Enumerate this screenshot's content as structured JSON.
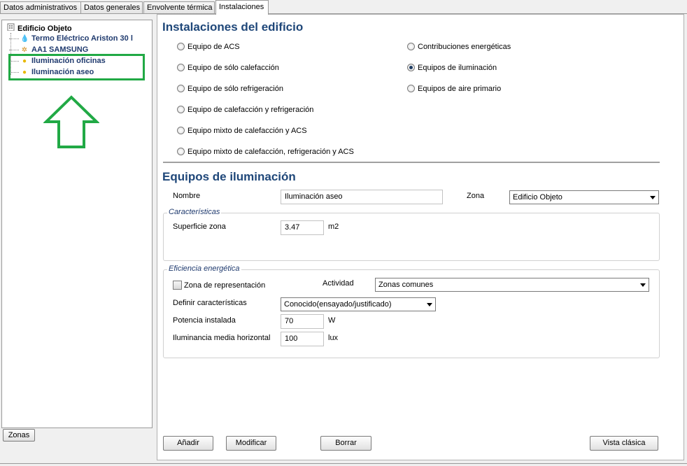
{
  "tabs": [
    "Datos administrativos",
    "Datos generales",
    "Envolvente térmica",
    "Instalaciones"
  ],
  "tree": {
    "root": "Edificio Objeto",
    "items": [
      {
        "label": "Termo Eléctrico Ariston 30 l",
        "icon": "water-drop-icon",
        "color": "#2a7fd4"
      },
      {
        "label": "AA1 SAMSUNG",
        "icon": "hvac-icon",
        "color": "#d08a1a"
      },
      {
        "label": "Iluminación oficinas",
        "icon": "lightbulb-icon",
        "color": "#e8b800"
      },
      {
        "label": "Iluminación aseo",
        "icon": "lightbulb-icon",
        "color": "#e8b800"
      }
    ]
  },
  "zonas_button": "Zonas",
  "section1": {
    "title": "Instalaciones del edificio",
    "left_options": [
      "Equipo de ACS",
      "Equipo de sólo calefacción",
      "Equipo de sólo refrigeración",
      "Equipo de calefacción y refrigeración",
      "Equipo mixto de calefacción y ACS",
      "Equipo mixto de calefacción, refrigeración y ACS"
    ],
    "right_options": [
      "Contribuciones energéticas",
      "Equipos de iluminación",
      "Equipos de aire primario"
    ],
    "selected": "Equipos de iluminación"
  },
  "section2": {
    "title": "Equipos de iluminación",
    "nombre_label": "Nombre",
    "nombre_value": "Iluminación aseo",
    "zona_label": "Zona",
    "zona_value": "Edificio Objeto",
    "caracteristicas": {
      "title": "Características",
      "superficie_label": "Superficie zona",
      "superficie_value": "3.47",
      "superficie_unit": "m2"
    },
    "eficiencia": {
      "title": "Eficiencia energética",
      "zona_rep_label": "Zona de representación",
      "zona_rep_checked": false,
      "actividad_label": "Actividad",
      "actividad_value": "Zonas comunes",
      "definir_label": "Definir características",
      "definir_value": "Conocido(ensayado/justificado)",
      "potencia_label": "Potencia instalada",
      "potencia_value": "70",
      "potencia_unit": "W",
      "ilum_label": "Iluminancia media horizontal",
      "ilum_value": "100",
      "ilum_unit": "lux"
    }
  },
  "buttons": {
    "add": "Añadir",
    "modify": "Modificar",
    "delete": "Borrar",
    "classic": "Vista clásica"
  },
  "annotation": {
    "color": "#21a945"
  }
}
